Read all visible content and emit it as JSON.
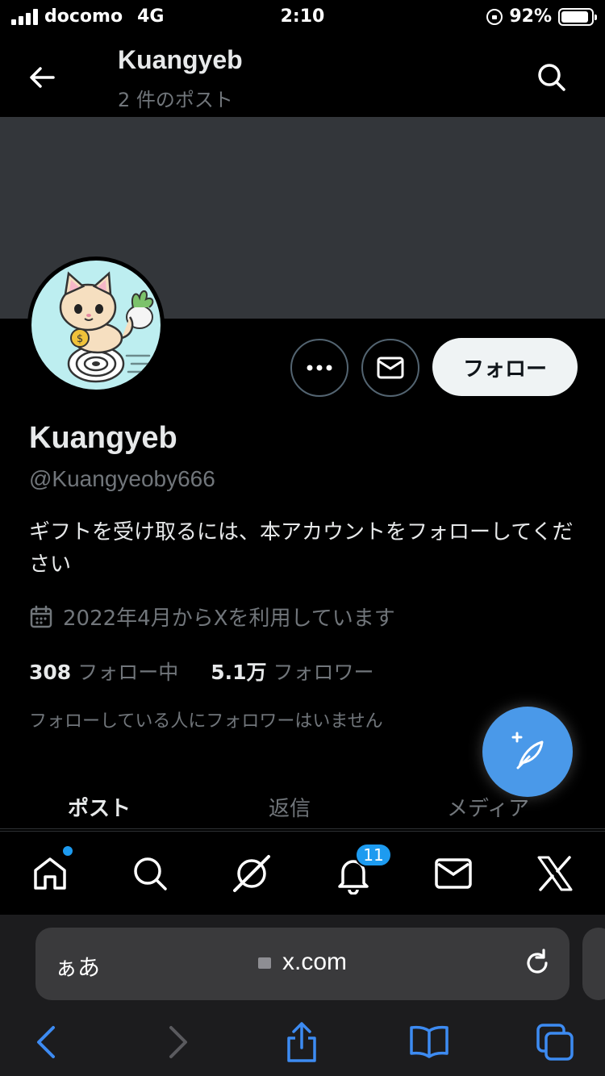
{
  "status_bar": {
    "carrier": "docomo",
    "network": "4G",
    "time": "2:10",
    "battery_percent": "92%",
    "battery_level": 0.92
  },
  "header": {
    "title": "Kuangyeb",
    "post_count": "2 件のポスト"
  },
  "profile": {
    "name": "Kuangyeb",
    "handle": "@Kuangyeoby666",
    "bio": "ギフトを受け取るには、本アカウントをフォローしてください",
    "joined": "2022年4月からXを利用しています",
    "following_count": "308",
    "following_label": "フォロー中",
    "followers_count": "5.1万",
    "followers_label": "フォロワー",
    "no_followers_note": "フォローしている人にフォロワーはいません",
    "follow_button": "フォロー"
  },
  "tabs": [
    {
      "label": "ポスト",
      "active": true
    },
    {
      "label": "返信",
      "active": false
    },
    {
      "label": "メディア",
      "active": false
    }
  ],
  "bottom_nav": {
    "notifications_badge": "11",
    "items": [
      "home-icon",
      "search-icon",
      "grok-icon",
      "bell-icon",
      "mail-icon",
      "x-logo-icon"
    ]
  },
  "safari": {
    "aa_label": "ぁあ",
    "domain": "x.com"
  },
  "colors": {
    "accent": "#1d9bf0",
    "fab": "#4a99e9",
    "banner": "#33363a",
    "secondary_text": "#71767b"
  }
}
